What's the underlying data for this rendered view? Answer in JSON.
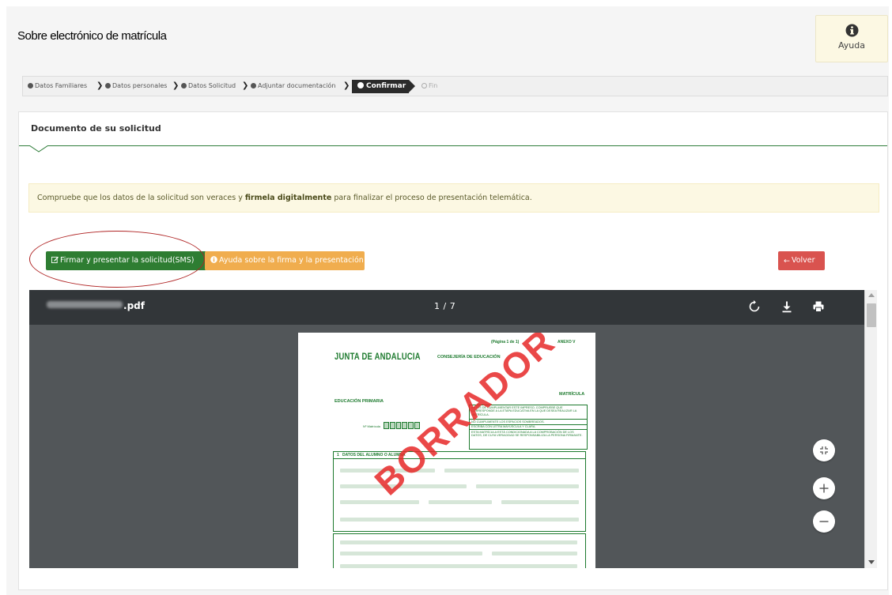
{
  "header": {
    "title": "Sobre electrónico de matrícula",
    "help_label": "Ayuda"
  },
  "wizard": {
    "steps": [
      {
        "label": "Datos Familiares",
        "state": "done"
      },
      {
        "label": "Datos personales",
        "state": "done"
      },
      {
        "label": "Datos Solicitud",
        "state": "done"
      },
      {
        "label": "Adjuntar documentación",
        "state": "done"
      },
      {
        "label": "Confirmar",
        "state": "active"
      },
      {
        "label": "Fin",
        "state": "pending"
      }
    ]
  },
  "panel": {
    "title": "Documento de su solicitud",
    "alert_before": "Compruebe que los datos de la solicitud son veraces y ",
    "alert_bold": "firmela digitalmente",
    "alert_after": " para finalizar el proceso de presentación telemática."
  },
  "buttons": {
    "sign": "Firmar y presentar la solicitud(SMS)",
    "help": "Ayuda sobre la firma y la presentación",
    "back": "Volver"
  },
  "viewer": {
    "file_suffix": "pdf",
    "page_indicator": "1 / 7",
    "page": {
      "page_label": "(Página 1 de 1)",
      "anexo": "ANEXO V",
      "org": "JUNTA DE ANDALUCIA",
      "dept": "CONSEJERÍA DE EDUCACIÓN",
      "form_type": "MATRÍCULA",
      "level": "EDUCACIÓN PRIMARIA",
      "notice_1": "ANTES DE CUMPLIMENTAR ESTE IMPRESO, COMPRUEBE QUE CORRESPONDE A LA ETAPA EDUCATIVA EN LA QUE DESEA REALIZAR LA MATRÍCULA.",
      "notice_2": "NO CUMPLIMENTE LOS ESPACIOS SOMBREADOS.",
      "notice_3": "ESCRIBA CON LETRA MAYÚSCULA Y CLARA.",
      "notice_4": "ESTA MATRÍCULA ESTÁ CONDICIONADA A LA COMPROBACIÓN DE LOS DATOS, DE CUYA VERACIDAD SE RESPONSABILIZA LA PERSONA FIRMANTE.",
      "matricula_label": "Nº Matrícula",
      "section_num": "1",
      "section_title": "DATOS DEL ALUMNO O ALUMNA",
      "stamp": "BORRADOR"
    }
  },
  "colors": {
    "primary_green": "#2e7d32",
    "warning": "#f0ad4e",
    "danger": "#d9534f",
    "doc_green": "#1d7a2e"
  }
}
